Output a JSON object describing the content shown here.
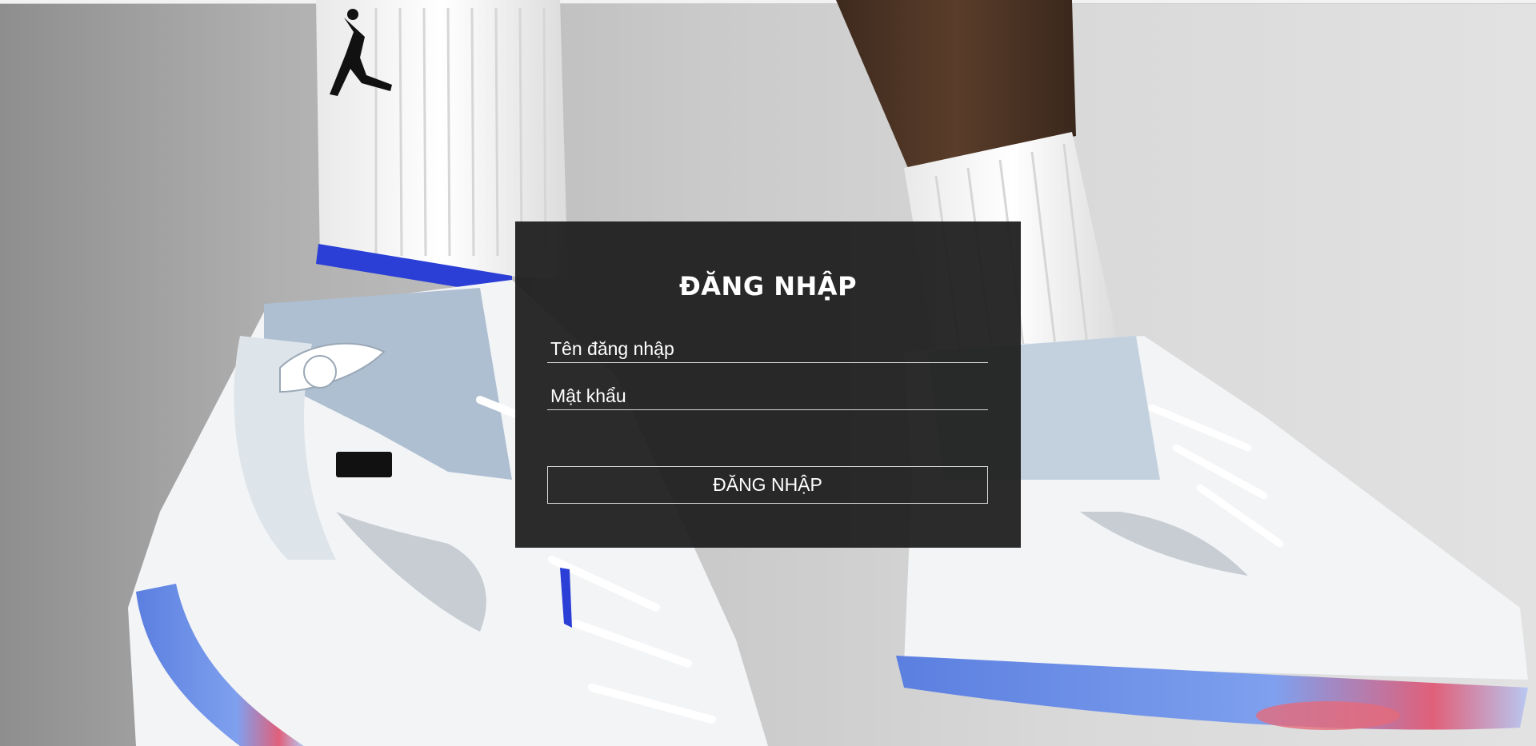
{
  "login": {
    "title": "ĐĂNG NHẬP",
    "username_placeholder": "Tên đăng nhập",
    "password_placeholder": "Mật khẩu",
    "submit_label": "ĐĂNG NHẬP"
  },
  "colors": {
    "panel_background": "#1e1e1e",
    "text": "#ffffff",
    "border": "#d8d8d8",
    "accent_blue": "#2b3fd6"
  }
}
